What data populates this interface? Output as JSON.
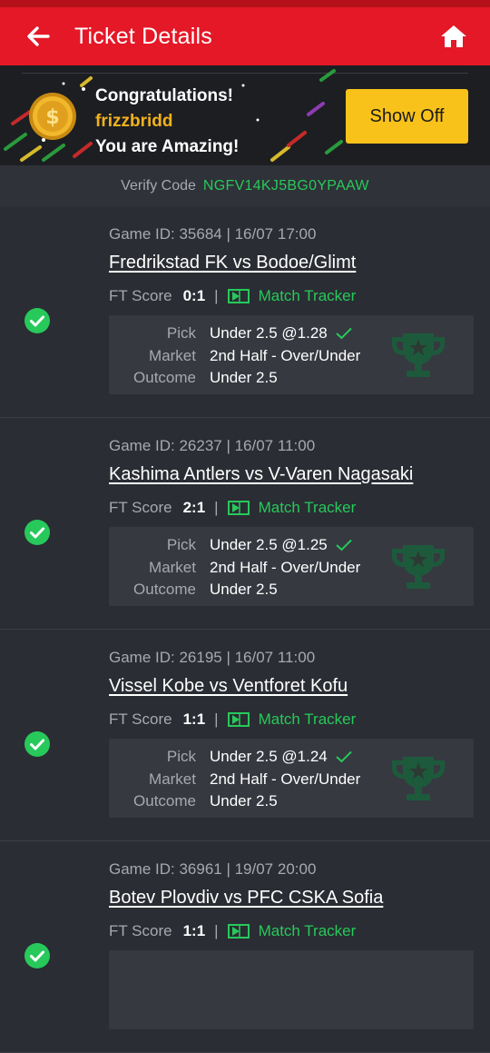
{
  "header": {
    "title": "Ticket Details",
    "back_icon": "arrow-left-icon",
    "home_icon": "home-icon"
  },
  "banner": {
    "line1": "Congratulations!",
    "line2": "frizzbridd",
    "line3": "You are Amazing!",
    "button_label": "Show Off",
    "accent": "#f8c21a"
  },
  "verify": {
    "label": "Verify Code",
    "code": "NGFV14KJ5BG0YPAAW"
  },
  "labels": {
    "ft_score": "FT Score",
    "separator": "|",
    "match_tracker": "Match Tracker",
    "pick": "Pick",
    "market": "Market",
    "outcome": "Outcome"
  },
  "colors": {
    "header_red": "#e41827",
    "win_green": "#27c95b",
    "gold": "#f3b21b"
  },
  "tickets": [
    {
      "game_id": "Game ID: 35684 | 16/07 17:00",
      "match": "Fredrikstad FK vs Bodoe/Glimt",
      "ft_score": "0:1",
      "pick": "Under 2.5 @1.28",
      "market": "2nd Half - Over/Under",
      "outcome": "Under 2.5",
      "status": "won"
    },
    {
      "game_id": "Game ID: 26237 | 16/07 11:00",
      "match": "Kashima Antlers vs V-Varen Nagasaki",
      "ft_score": "2:1",
      "pick": "Under 2.5 @1.25",
      "market": "2nd Half - Over/Under",
      "outcome": "Under 2.5",
      "status": "won"
    },
    {
      "game_id": "Game ID: 26195 | 16/07 11:00",
      "match": "Vissel Kobe vs Ventforet Kofu",
      "ft_score": "1:1",
      "pick": "Under 2.5 @1.24",
      "market": "2nd Half - Over/Under",
      "outcome": "Under 2.5",
      "status": "won"
    },
    {
      "game_id": "Game ID: 36961 | 19/07 20:00",
      "match": "Botev Plovdiv vs PFC CSKA Sofia",
      "ft_score": "1:1",
      "pick": "",
      "market": "",
      "outcome": "",
      "status": "won"
    }
  ]
}
